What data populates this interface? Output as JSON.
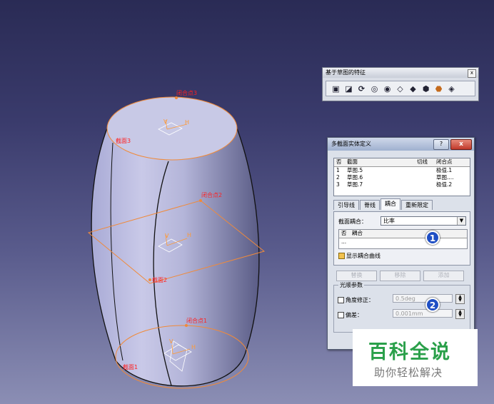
{
  "toolbar": {
    "title": "基于草图的特征",
    "close_label": "x",
    "icons": [
      "pad-icon",
      "pocket-icon",
      "shaft-icon",
      "groove-icon",
      "hole-icon",
      "rib-icon",
      "slot-icon",
      "multi-sections-solid-icon",
      "removed-multi-sections-icon",
      "solid-combine-icon"
    ]
  },
  "dialog": {
    "title": "多截面实体定义",
    "help_label": "?",
    "close_label": "x",
    "sections_list": {
      "headers": [
        "否",
        "截面",
        "切线",
        "闭合点"
      ],
      "rows": [
        {
          "no": "1",
          "section": "草图.5",
          "tangent": "",
          "closing": "极值.1"
        },
        {
          "no": "2",
          "section": "草图.6",
          "tangent": "",
          "closing": "草图...."
        },
        {
          "no": "3",
          "section": "草图.7",
          "tangent": "",
          "closing": "极值.2"
        }
      ]
    },
    "tabs": [
      "引导线",
      "脊线",
      "耦合",
      "重新限定"
    ],
    "active_tab": "耦合",
    "coupling_label": "截面耦合：",
    "coupling_value": "比率",
    "coupling_list": {
      "headers": [
        "否",
        "耦合"
      ],
      "rows": [
        "..."
      ]
    },
    "show_coupling_curves": "显示耦合曲线",
    "buttons": [
      "替换",
      "移除",
      "添加"
    ],
    "smoothing": {
      "legend": "光顺参数",
      "angle_label": "角度修正：",
      "angle_value": "0.5deg",
      "deviation_label": "偏差：",
      "deviation_value": "0.001mm"
    }
  },
  "viewport": {
    "labels": {
      "closing_top": "闭合点3",
      "section_top": "截面3",
      "closing_mid": "闭合点2",
      "section_mid": "截面2",
      "closing_bot": "闭合点1",
      "section_bot": "截面1"
    },
    "axis_v": "V",
    "axis_h": "H"
  },
  "markers": [
    "1",
    "2"
  ],
  "watermark": {
    "main": "百科全说",
    "sub": "助你轻松解决"
  },
  "colors": {
    "label_red": "#ff2020",
    "section_orange": "#f08a3a",
    "marker_blue": "#1f4fc4",
    "watermark_green": "#2aa04a"
  }
}
